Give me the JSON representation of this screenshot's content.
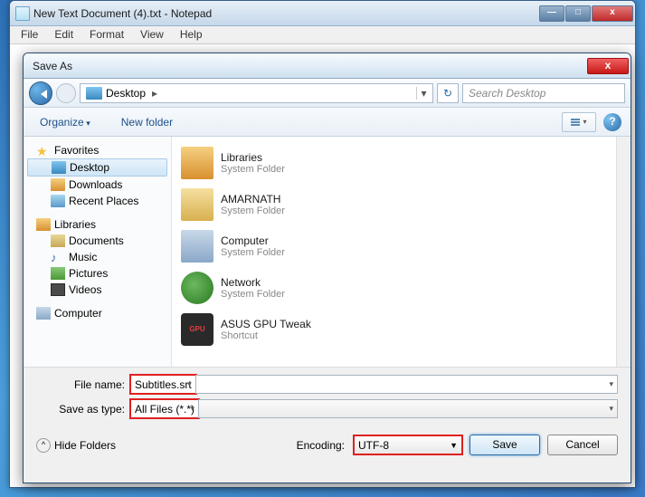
{
  "notepad": {
    "title": "New Text Document (4).txt - Notepad",
    "menu": {
      "file": "File",
      "edit": "Edit",
      "format": "Format",
      "view": "View",
      "help": "Help"
    }
  },
  "dialog": {
    "title": "Save As",
    "nav": {
      "location": "Desktop",
      "searchPlaceholder": "Search Desktop"
    },
    "toolbar": {
      "organize": "Organize",
      "newfolder": "New folder"
    },
    "tree": {
      "favorites": "Favorites",
      "desktop": "Desktop",
      "downloads": "Downloads",
      "recent": "Recent Places",
      "libraries": "Libraries",
      "documents": "Documents",
      "music": "Music",
      "pictures": "Pictures",
      "videos": "Videos",
      "computer": "Computer"
    },
    "files": [
      {
        "name": "Libraries",
        "sub": "System Folder"
      },
      {
        "name": "AMARNATH",
        "sub": "System Folder"
      },
      {
        "name": "Computer",
        "sub": "System Folder"
      },
      {
        "name": "Network",
        "sub": "System Folder"
      },
      {
        "name": "ASUS GPU Tweak",
        "sub": "Shortcut"
      }
    ],
    "inputs": {
      "filenameLabel": "File name:",
      "filenameValue": "Subtitles.srt",
      "typeLabel": "Save as type:",
      "typeValue": "All Files  (*.*)"
    },
    "footer": {
      "hide": "Hide Folders",
      "encodingLabel": "Encoding:",
      "encodingValue": "UTF-8",
      "save": "Save",
      "cancel": "Cancel"
    }
  }
}
